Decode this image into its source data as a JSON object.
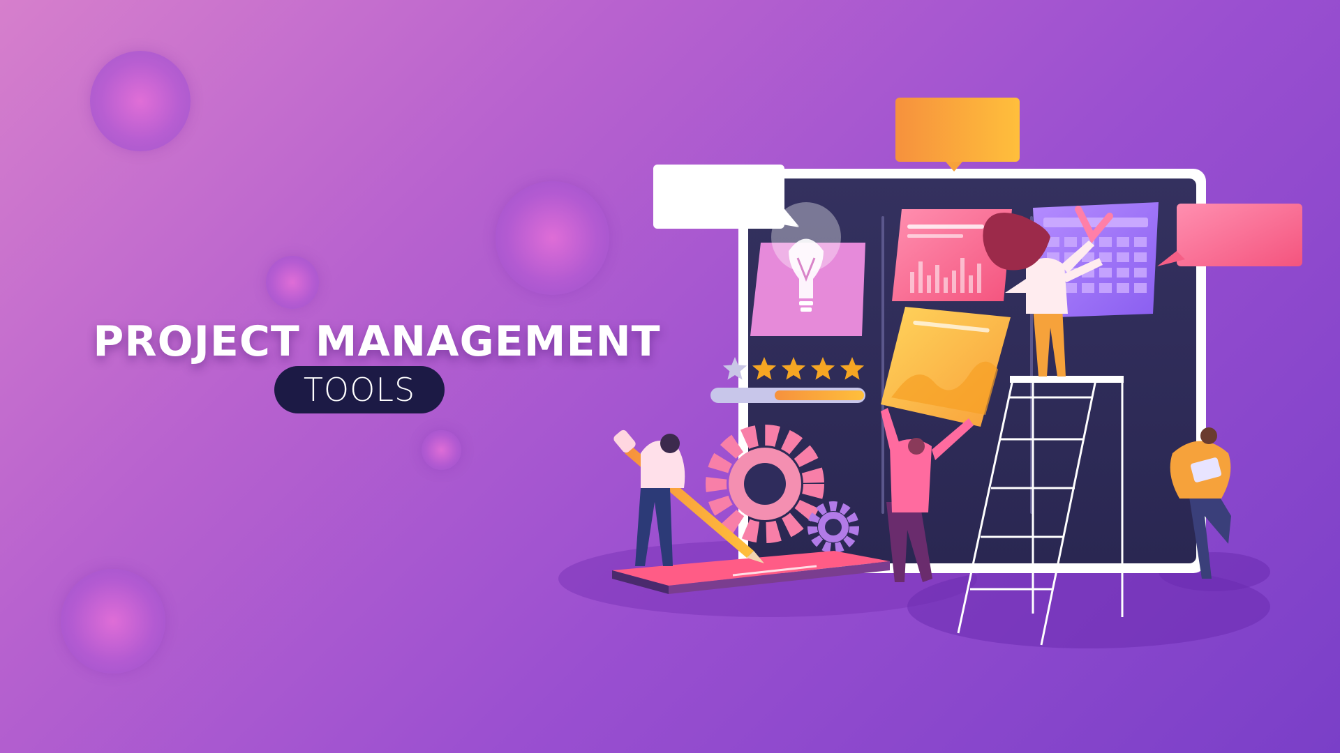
{
  "banner": {
    "headline": "PROJECT MANAGEMENT",
    "subheading": "TOOLS"
  },
  "illustration": {
    "rating_stars_filled": 4,
    "rating_stars_total": 5
  },
  "colors": {
    "background_start": "#d67fcc",
    "background_end": "#7a3fc8",
    "board": "#2f2c5c",
    "pill": "#1c1a45",
    "star": "#f6a623"
  }
}
